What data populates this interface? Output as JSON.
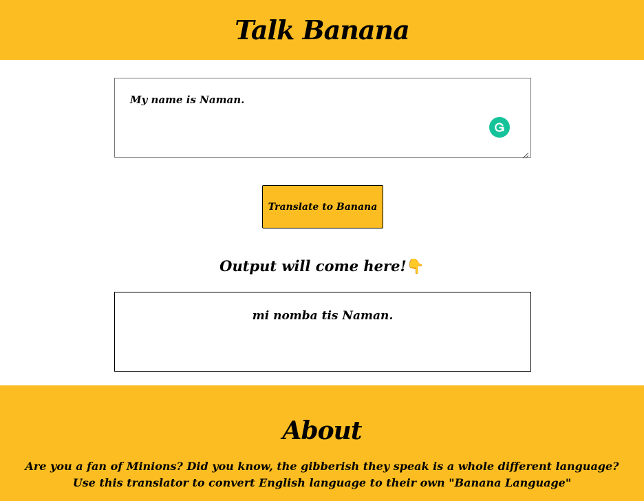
{
  "header": {
    "title": "Talk Banana"
  },
  "input": {
    "value": "My name is Naman."
  },
  "translate_button": {
    "label": "Translate to Banana"
  },
  "output": {
    "heading": "Output will come here!",
    "pointer_emoji": "👇",
    "text": "mi nomba tis Naman."
  },
  "about": {
    "title": "About",
    "body": "Are you a fan of Minions? Did you know, the gibberish they speak is a whole different language? Use this translator to convert English language to their own \"Banana Language\""
  },
  "colors": {
    "accent": "#fbbd22",
    "grammarly": "#15c39a"
  },
  "icons": {
    "grammarly": "grammarly-icon",
    "pointer": "pointing-down-icon",
    "resize": "resize-grip-icon"
  }
}
